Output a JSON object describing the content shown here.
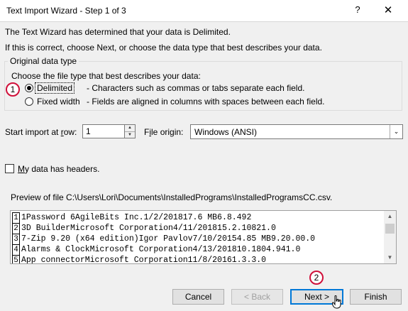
{
  "window": {
    "title": "Text Import Wizard - Step 1 of 3",
    "help_glyph": "?",
    "close_glyph": "✕"
  },
  "intro": {
    "line1": "The Text Wizard has determined that your data is Delimited.",
    "line2": "If this is correct, choose Next, or choose the data type that best describes your data."
  },
  "original_data_type": {
    "group_label": "Original data type",
    "prompt": "Choose the file type that best describes your data:",
    "options": [
      {
        "label": "Delimited",
        "description": "- Characters such as commas or tabs separate each field.",
        "selected": true
      },
      {
        "label": "Fixed width",
        "description": "- Fields are aligned in columns with spaces between each field.",
        "selected": false
      }
    ]
  },
  "start_import": {
    "label_prefix": "Start import at ",
    "label_hotkey": "r",
    "label_suffix": "ow:",
    "value": "1"
  },
  "file_origin": {
    "label_prefix": "F",
    "label_hotkey": "i",
    "label_suffix": "le origin:",
    "value": "Windows (ANSI)"
  },
  "headers_checkbox": {
    "label_hotkey": "M",
    "label_suffix": "y data has headers.",
    "checked": false
  },
  "preview": {
    "label": "Preview of file C:\\Users\\Lori\\Documents\\InstalledPrograms\\InstalledProgramsCC.csv.",
    "rows": [
      {
        "num": "1",
        "text": "1Password 6AgileBits Inc.1/2/201817.6 MB6.8.492"
      },
      {
        "num": "2",
        "text": "3D BuilderMicrosoft Corporation4/11/201815.2.10821.0"
      },
      {
        "num": "3",
        "text": "7-Zip 9.20 (x64 edition)Igor Pavlov7/10/20154.85 MB9.20.00.0"
      },
      {
        "num": "4",
        "text": "Alarms & ClockMicrosoft Corporation4/13/201810.1804.941.0"
      },
      {
        "num": "5",
        "text": "App connectorMicrosoft Corporation11/8/20161.3.3.0"
      }
    ]
  },
  "callouts": {
    "one": "1",
    "two": "2"
  },
  "buttons": {
    "cancel": "Cancel",
    "back": "< Back",
    "next": "Next >",
    "finish": "Finish"
  },
  "icons": {
    "spin_up": "▲",
    "spin_down": "▼",
    "dropdown": "⌄",
    "scroll_up": "▲",
    "scroll_down": "▼"
  }
}
